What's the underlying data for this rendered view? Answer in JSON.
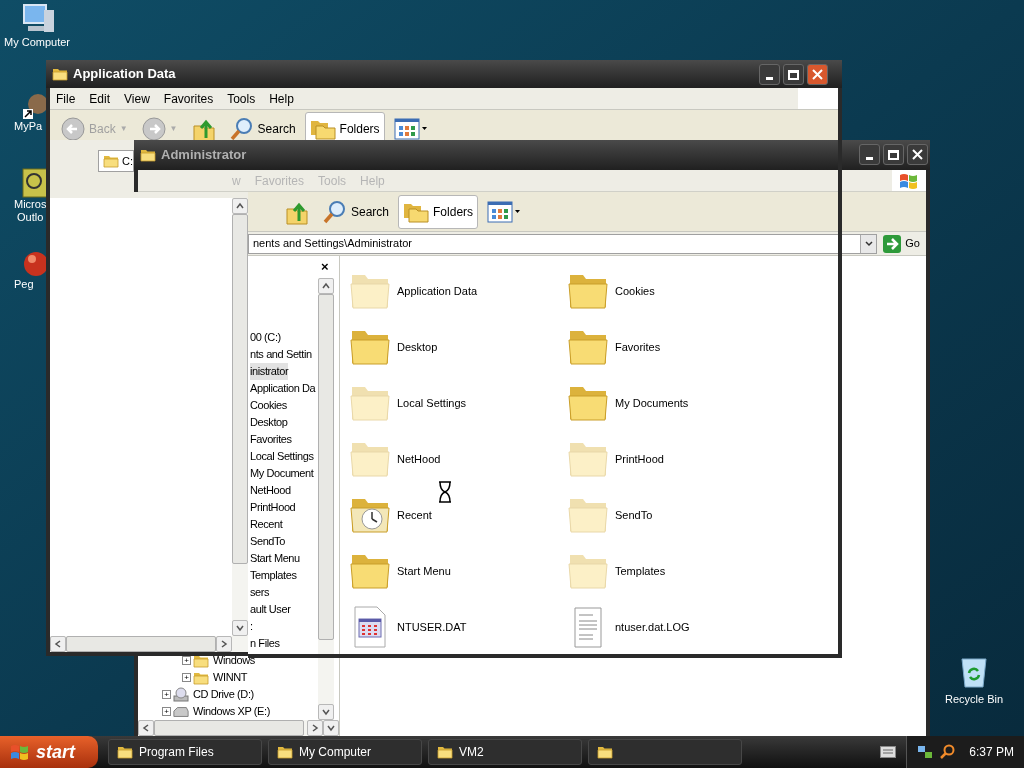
{
  "desktop_icons": [
    {
      "kind": "computer",
      "lines": [
        "My Computer"
      ]
    },
    {
      "kind": "shortcut",
      "lines": [
        "MyPa"
      ]
    },
    {
      "kind": "outlook",
      "lines": [
        "Micros",
        "Outlo"
      ]
    },
    {
      "kind": "ball",
      "lines": [
        "Peg"
      ]
    }
  ],
  "recycle_bin": {
    "label": "Recycle Bin"
  },
  "front_window": {
    "title": "Application Data",
    "active": true,
    "menu": [
      "File",
      "Edit",
      "View",
      "Favorites",
      "Tools",
      "Help"
    ],
    "toolbar": [
      {
        "kind": "back",
        "label": "Back",
        "caret": "▼",
        "disabled": true,
        "pressed": false
      },
      {
        "kind": "forward",
        "caret": "▼",
        "disabled": true,
        "pressed": false
      },
      {
        "kind": "up",
        "pressed": false
      },
      {
        "kind": "search",
        "label": "Search",
        "pressed": false
      },
      {
        "kind": "folders",
        "label": "Folders",
        "pressed": true
      },
      {
        "kind": "views",
        "pressed": false
      }
    ],
    "address": "C:"
  },
  "back_window": {
    "title": "Administrator",
    "active": false,
    "menu": [
      "w",
      "Favorites",
      "Tools",
      "Help"
    ],
    "toolbar": [
      {
        "kind": "up",
        "pressed": false
      },
      {
        "kind": "search",
        "label": "Search",
        "pressed": false
      },
      {
        "kind": "folders",
        "label": "Folders",
        "pressed": true
      },
      {
        "kind": "views",
        "pressed": false
      }
    ],
    "address": "nents and Settings\\Administrator",
    "go": "Go",
    "pane_close": "×",
    "tree": [
      {
        "label": "00 (C:)",
        "selected": false,
        "children": [
          {
            "label": "nts and Settin",
            "selected": false,
            "children": [
              {
                "label": "inistrator",
                "selected": true,
                "children": [
                  {
                    "label": "Application Da",
                    "selected": false
                  },
                  {
                    "label": "Cookies",
                    "selected": false
                  },
                  {
                    "label": "Desktop",
                    "selected": false
                  },
                  {
                    "label": "Favorites",
                    "selected": false
                  },
                  {
                    "label": "Local Settings",
                    "selected": false
                  },
                  {
                    "label": "My Document",
                    "selected": false
                  },
                  {
                    "label": "NetHood",
                    "selected": false
                  },
                  {
                    "label": "PrintHood",
                    "selected": false
                  },
                  {
                    "label": "Recent",
                    "selected": false
                  },
                  {
                    "label": "SendTo",
                    "selected": false
                  },
                  {
                    "label": "Start Menu",
                    "selected": false
                  },
                  {
                    "label": "Templates",
                    "selected": false
                  }
                ]
              },
              {
                "label": "sers",
                "selected": false
              },
              {
                "label": "ault User",
                "selected": false
              },
              {
                "label": ":",
                "selected": false
              }
            ]
          },
          {
            "label": "n Files",
            "selected": false
          },
          {
            "label": "Windows",
            "kind": "folder",
            "selected": false,
            "toggle": "+"
          },
          {
            "label": "WINNT",
            "kind": "folder",
            "selected": false,
            "toggle": "+"
          }
        ]
      },
      {
        "label": "CD Drive (D:)",
        "kind": "cd",
        "selected": false,
        "toggle": "+"
      },
      {
        "label": "Windows XP (E:)",
        "kind": "drive",
        "selected": false,
        "toggle": "+"
      }
    ],
    "items": [
      {
        "label": "Application Data",
        "kind": "folder",
        "hidden": true
      },
      {
        "label": "Cookies",
        "kind": "folder",
        "hidden": false
      },
      {
        "label": "Desktop",
        "kind": "folder",
        "hidden": false
      },
      {
        "label": "Favorites",
        "kind": "folder",
        "hidden": false
      },
      {
        "label": "Local Settings",
        "kind": "folder",
        "hidden": true
      },
      {
        "label": "My Documents",
        "kind": "folder",
        "hidden": false
      },
      {
        "label": "NetHood",
        "kind": "folder",
        "hidden": true
      },
      {
        "label": "PrintHood",
        "kind": "folder",
        "hidden": true
      },
      {
        "label": "Recent",
        "kind": "recent",
        "hidden": false
      },
      {
        "label": "SendTo",
        "kind": "folder",
        "hidden": true
      },
      {
        "label": "Start Menu",
        "kind": "folder",
        "hidden": false
      },
      {
        "label": "Templates",
        "kind": "folder",
        "hidden": true
      },
      {
        "label": "NTUSER.DAT",
        "kind": "dat",
        "hidden": false
      },
      {
        "label": "ntuser.dat.LOG",
        "kind": "log",
        "hidden": false
      }
    ]
  },
  "taskbar": {
    "start": "start",
    "tasks": [
      {
        "kind": "folder",
        "label": "Program Files"
      },
      {
        "kind": "folder",
        "label": "My Computer"
      },
      {
        "kind": "folder",
        "label": "VM2"
      },
      {
        "kind": "folder"
      }
    ],
    "clock": "6:37 PM"
  }
}
